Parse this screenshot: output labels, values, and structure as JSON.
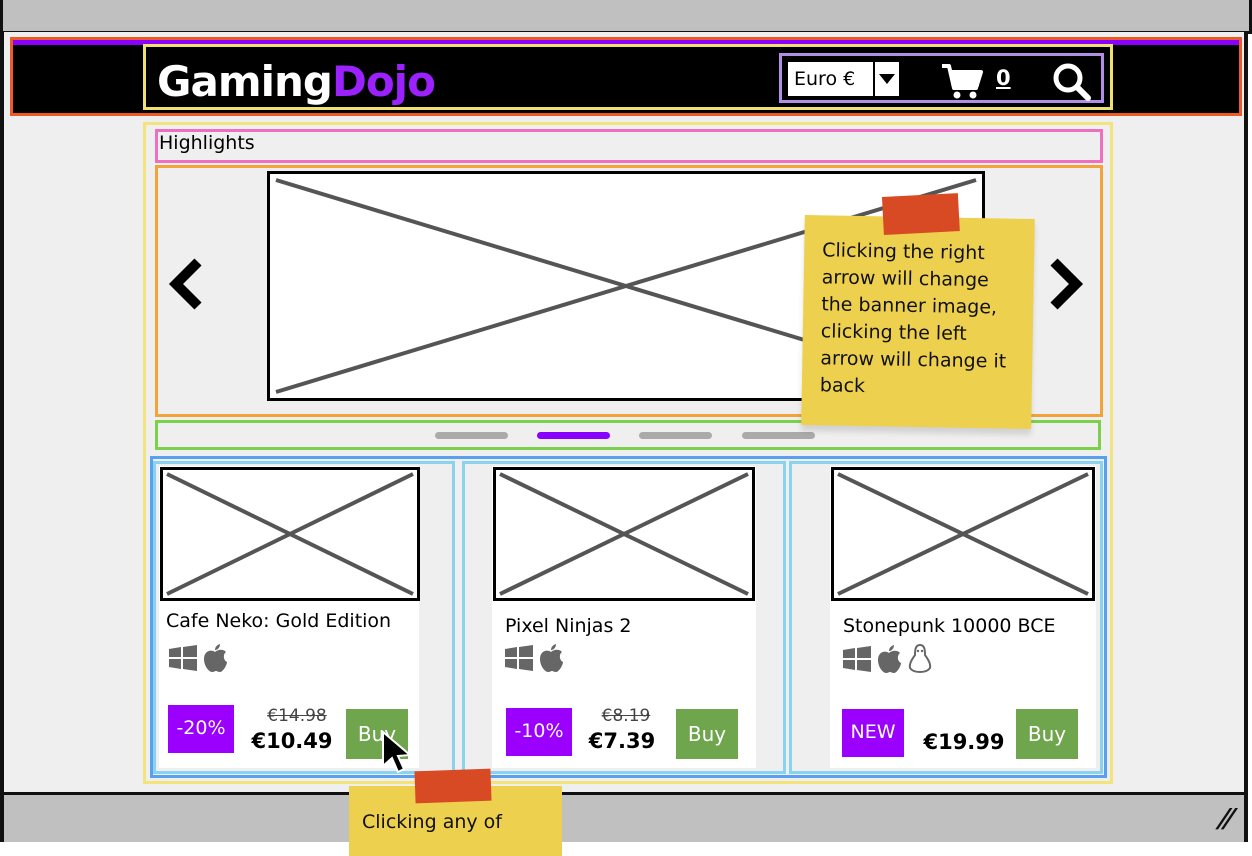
{
  "header": {
    "logo_part1": "Gaming",
    "logo_part2": "Dojo",
    "currency_value": "Euro €",
    "cart_count": "0",
    "accent_color": "#9b22ff"
  },
  "highlights": {
    "title": "Highlights",
    "banner_note": "Clicking the right arrow will change the banner image, clicking the left arrow will change it back",
    "active_dot": 1,
    "dot_count": 4
  },
  "products": [
    {
      "title": "Cafe Neko: Gold Edition",
      "badge": "-20%",
      "old_price": "€14.98",
      "price": "€10.49",
      "buy": "Buy",
      "platforms": [
        "windows",
        "apple"
      ]
    },
    {
      "title": "Pixel Ninjas 2",
      "badge": "-10%",
      "old_price": "€8.19",
      "price": "€7.39",
      "buy": "Buy",
      "platforms": [
        "windows",
        "apple"
      ]
    },
    {
      "title": "Stonepunk 10000 BCE",
      "badge": "NEW",
      "old_price": "",
      "price": "€19.99",
      "buy": "Buy",
      "platforms": [
        "windows",
        "apple",
        "linux"
      ]
    }
  ],
  "buy_note": "Clicking any of",
  "colors": {
    "badge": "#9b00ff",
    "buy": "#6ea54d",
    "header": "#000000"
  }
}
